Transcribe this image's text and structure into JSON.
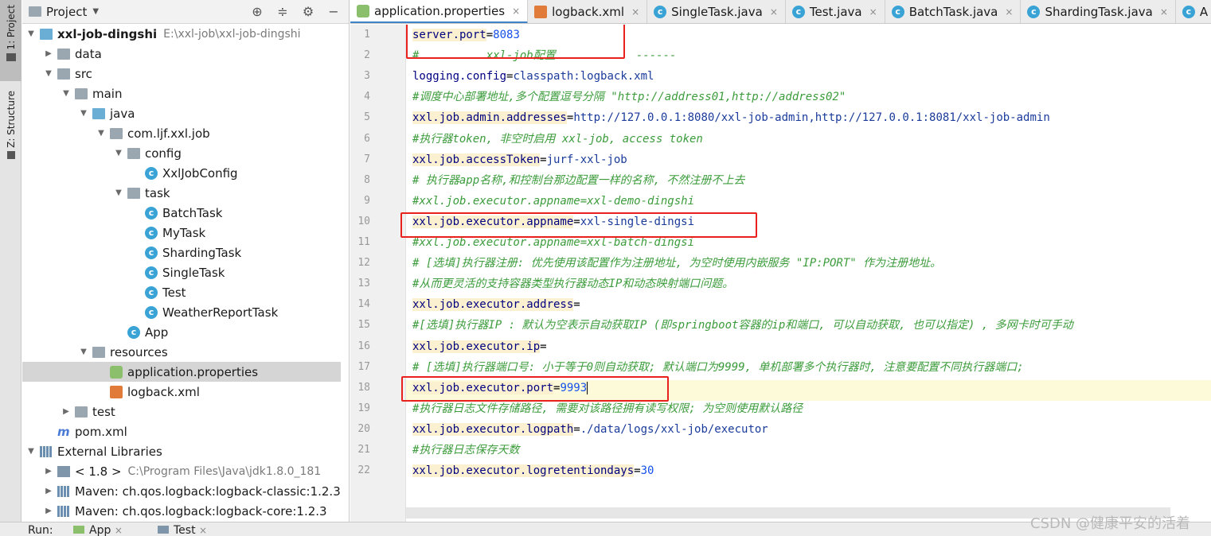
{
  "strip": {
    "project_tab": "1: Project",
    "structure_tab": "Z: Structure"
  },
  "project_panel": {
    "title": "Project",
    "tree": [
      {
        "label": "xxl-job-dingshi",
        "path": "E:\\xxl-job\\xxl-job-dingshi",
        "icon": "module-folder-icon"
      },
      {
        "label": "data",
        "icon": "folder-icon"
      },
      {
        "label": "src",
        "icon": "folder-icon"
      },
      {
        "label": "main",
        "icon": "folder-icon"
      },
      {
        "label": "java",
        "icon": "source-folder-icon"
      },
      {
        "label": "com.ljf.xxl.job",
        "icon": "package-icon"
      },
      {
        "label": "config",
        "icon": "package-icon"
      },
      {
        "label": "XxlJobConfig",
        "icon": "class-icon"
      },
      {
        "label": "task",
        "icon": "package-icon"
      },
      {
        "label": "BatchTask",
        "icon": "class-icon"
      },
      {
        "label": "MyTask",
        "icon": "class-icon"
      },
      {
        "label": "ShardingTask",
        "icon": "class-icon"
      },
      {
        "label": "SingleTask",
        "icon": "class-icon"
      },
      {
        "label": "Test",
        "icon": "class-icon"
      },
      {
        "label": "WeatherReportTask",
        "icon": "class-icon"
      },
      {
        "label": "App",
        "icon": "spring-boot-class-icon"
      },
      {
        "label": "resources",
        "icon": "resources-folder-icon"
      },
      {
        "label": "application.properties",
        "icon": "properties-file-icon"
      },
      {
        "label": "logback.xml",
        "icon": "xml-file-icon"
      },
      {
        "label": "test",
        "icon": "folder-icon"
      },
      {
        "label": "pom.xml",
        "icon": "maven-icon"
      },
      {
        "label": "External Libraries",
        "icon": "library-icon"
      },
      {
        "label": "< 1.8 >",
        "path": "C:\\Program Files\\Java\\jdk1.8.0_181",
        "icon": "jdk-icon"
      },
      {
        "label": "Maven: ch.qos.logback:logback-classic:1.2.3",
        "icon": "library-icon"
      },
      {
        "label": "Maven: ch.qos.logback:logback-core:1.2.3",
        "icon": "library-icon"
      }
    ]
  },
  "tabs": [
    {
      "label": "application.properties",
      "icon": "properties-file-icon",
      "active": true
    },
    {
      "label": "logback.xml",
      "icon": "xml-file-icon"
    },
    {
      "label": "SingleTask.java",
      "icon": "class-icon"
    },
    {
      "label": "Test.java",
      "icon": "class-icon"
    },
    {
      "label": "BatchTask.java",
      "icon": "class-icon"
    },
    {
      "label": "ShardingTask.java",
      "icon": "class-icon"
    },
    {
      "label": "A",
      "icon": "class-icon"
    }
  ],
  "editor": {
    "lines": [
      {
        "n": "1",
        "key": "server.port",
        "eq": "=",
        "val": "8083"
      },
      {
        "n": "2",
        "comment": "#          xxl-job配置            ------"
      },
      {
        "n": "3",
        "key": "logging.config",
        "eq": "=",
        "val": "classpath:logback.xml",
        "plain": true
      },
      {
        "n": "4",
        "comment": "#调度中心部署地址,多个配置逗号分隔 \"http://address01,http://address02\""
      },
      {
        "n": "5",
        "key": "xxl.job.admin.addresses",
        "eq": "=",
        "val": "http://127.0.0.1:8080/xxl-job-admin,http://127.0.0.1:8081/xxl-job-admin"
      },
      {
        "n": "6",
        "comment": "#执行器token, 非空时启用 xxl-job, access token"
      },
      {
        "n": "7",
        "key": "xxl.job.accessToken",
        "eq": "=",
        "val": "jurf-xxl-job"
      },
      {
        "n": "8",
        "comment": "# 执行器app名称,和控制台那边配置一样的名称, 不然注册不上去"
      },
      {
        "n": "9",
        "comment": "#xxl.job.executor.appname=xxl-demo-dingshi"
      },
      {
        "n": "10",
        "key": "xxl.job.executor.appname",
        "eq": "=",
        "val": "xxl-single-dingsi"
      },
      {
        "n": "11",
        "comment": "#xxl.job.executor.appname=xxl-batch-dingsi"
      },
      {
        "n": "12",
        "comment": "# [选填]执行器注册: 优先使用该配置作为注册地址, 为空时使用内嵌服务 \"IP:PORT\" 作为注册地址。"
      },
      {
        "n": "13",
        "comment": "#从而更灵活的支持容器类型执行器动态IP和动态映射端口问题。"
      },
      {
        "n": "14",
        "key": "xxl.job.executor.address",
        "eq": "=",
        "val": ""
      },
      {
        "n": "15",
        "comment": "#[选填]执行器IP : 默认为空表示自动获取IP (即springboot容器的ip和端口, 可以自动获取, 也可以指定) , 多网卡时可手动"
      },
      {
        "n": "16",
        "key": "xxl.job.executor.ip",
        "eq": "=",
        "val": ""
      },
      {
        "n": "17",
        "comment": "# [选填]执行器端口号: 小于等于0则自动获取; 默认端口为9999, 单机部署多个执行器时, 注意要配置不同执行器端口;"
      },
      {
        "n": "18",
        "key": "xxl.job.executor.port",
        "eq": "=",
        "val": "9993"
      },
      {
        "n": "19",
        "comment": "#执行器日志文件存储路径, 需要对该路径拥有读写权限; 为空则使用默认路径"
      },
      {
        "n": "20",
        "key": "xxl.job.executor.logpath",
        "eq": "=",
        "val": "./data/logs/xxl-job/executor"
      },
      {
        "n": "21",
        "comment": "#执行器日志保存天数"
      },
      {
        "n": "22",
        "key": "xxl.job.executor.logretentiondays",
        "eq": "=",
        "val": "30"
      }
    ]
  },
  "runbar": {
    "label": "Run:",
    "tab1": "App",
    "tab2": "Test",
    "close": "×"
  },
  "watermark": "CSDN @健康平安的活着",
  "colors": {
    "highlight_box": "#e8211d",
    "tab_underline": "#4083c9",
    "key_bg": "#fbf0cf",
    "comment": "#3c9c3c"
  }
}
